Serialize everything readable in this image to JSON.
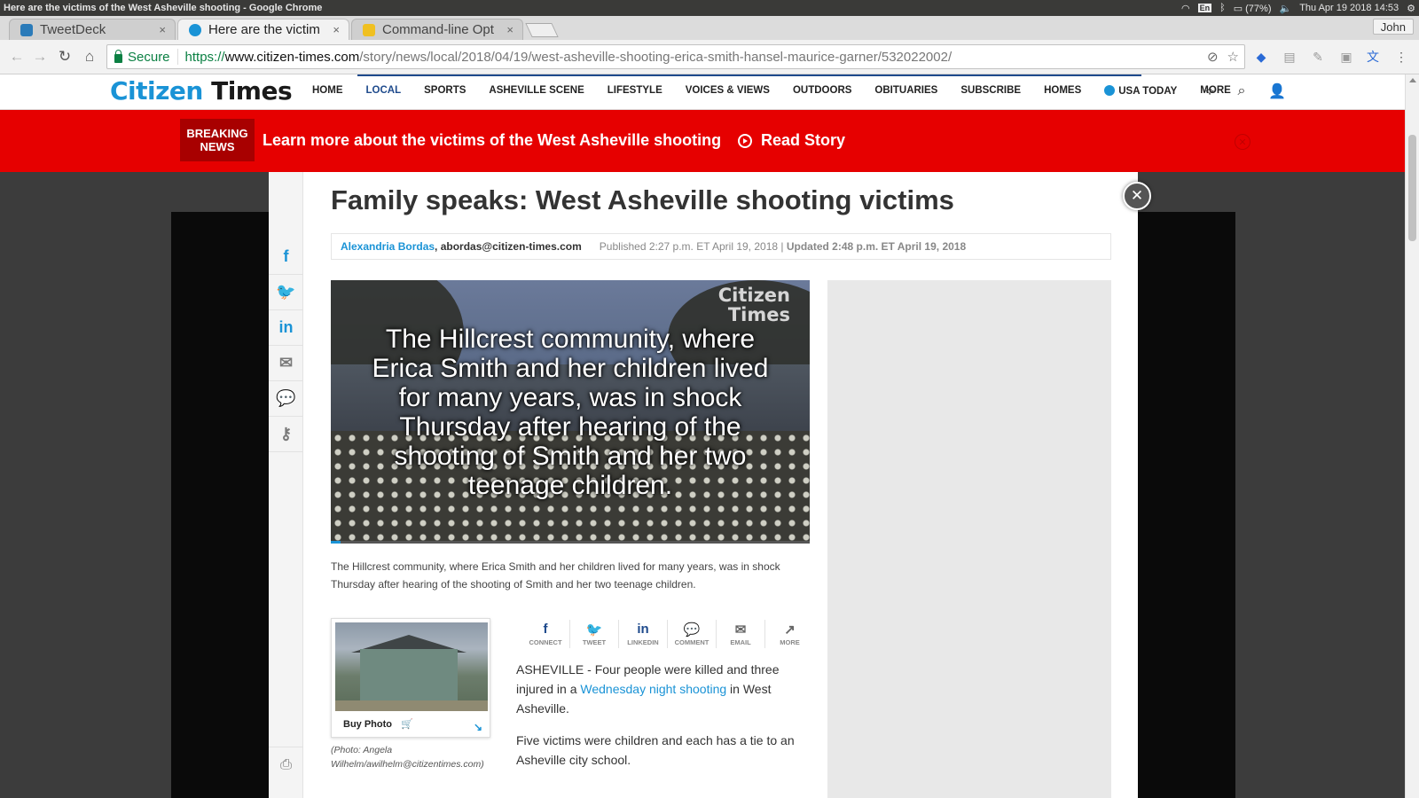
{
  "os": {
    "window_title": "Here are the victims of the West Asheville shooting - Google Chrome",
    "input_lang": "En",
    "battery": "(77%)",
    "clock": "Thu Apr 19 2018 14:53"
  },
  "browser": {
    "tabs": [
      {
        "label": "TweetDeck",
        "close": "×"
      },
      {
        "label": "Here are the victim",
        "close": "×"
      },
      {
        "label": "Command-line Opt",
        "close": "×"
      }
    ],
    "user": "John",
    "secure_label": "Secure",
    "url": {
      "proto": "https://",
      "host": "www.citizen-times.com",
      "path": "/story/news/local/2018/04/19/west-asheville-shooting-erica-smith-hansel-maurice-garner/532022002/"
    }
  },
  "site": {
    "logo_part1": "Citizen",
    "logo_part2": "Times",
    "nav": [
      "HOME",
      "LOCAL",
      "SPORTS",
      "ASHEVILLE SCENE",
      "LIFESTYLE",
      "VOICES & VIEWS",
      "OUTDOORS",
      "OBITUARIES",
      "SUBSCRIBE",
      "HOMES",
      "USA TODAY",
      "MORE"
    ]
  },
  "breaking": {
    "badge_line1": "BREAKING",
    "badge_line2": "NEWS",
    "headline": "Learn more about the victims of the West Asheville shooting",
    "read_story": "Read Story"
  },
  "article": {
    "title": "Family speaks: West Asheville shooting victims",
    "author": "Alexandria Bordas",
    "author_email": ", abordas@citizen-times.com",
    "published": "Published 2:27 p.m. ET April 19, 2018 |",
    "updated": "Updated 2:48 p.m. ET April 19, 2018",
    "video": {
      "watermark_line1": "Citizen",
      "watermark_line2": "Times",
      "overlay_text": "The Hillcrest community, where Erica Smith and her children lived for many years, was in shock Thursday after hearing of the shooting of Smith and her two teenage children.",
      "progress": 0.02
    },
    "caption": "The Hillcrest community, where Erica Smith and her children lived for many years, was in shock Thursday after hearing of the shooting of Smith and her two teenage children.",
    "buy_photo": "Buy Photo",
    "photo_credit": "(Photo: Angela Wilhelm/awilhelm@citizentimes.com)",
    "share": [
      {
        "icon": "f",
        "label": "CONNECT"
      },
      {
        "icon": "🐦",
        "label": "TWEET"
      },
      {
        "icon": "in",
        "label": "LINKEDIN"
      },
      {
        "icon": "💬",
        "label": "COMMENT"
      },
      {
        "icon": "✉",
        "label": "EMAIL"
      },
      {
        "icon": "↗",
        "label": "MORE"
      }
    ],
    "para1_a": "ASHEVILLE - Four people were killed and three injured in a ",
    "para1_link": "Wednesday night shooting",
    "para1_b": " in West Asheville.",
    "para2": "Five victims were children and each has a tie to an Asheville city school."
  },
  "colors": {
    "brand_blue": "#1a93d6",
    "breaking_red": "#e60000",
    "nav_active": "#1e4a8c"
  }
}
